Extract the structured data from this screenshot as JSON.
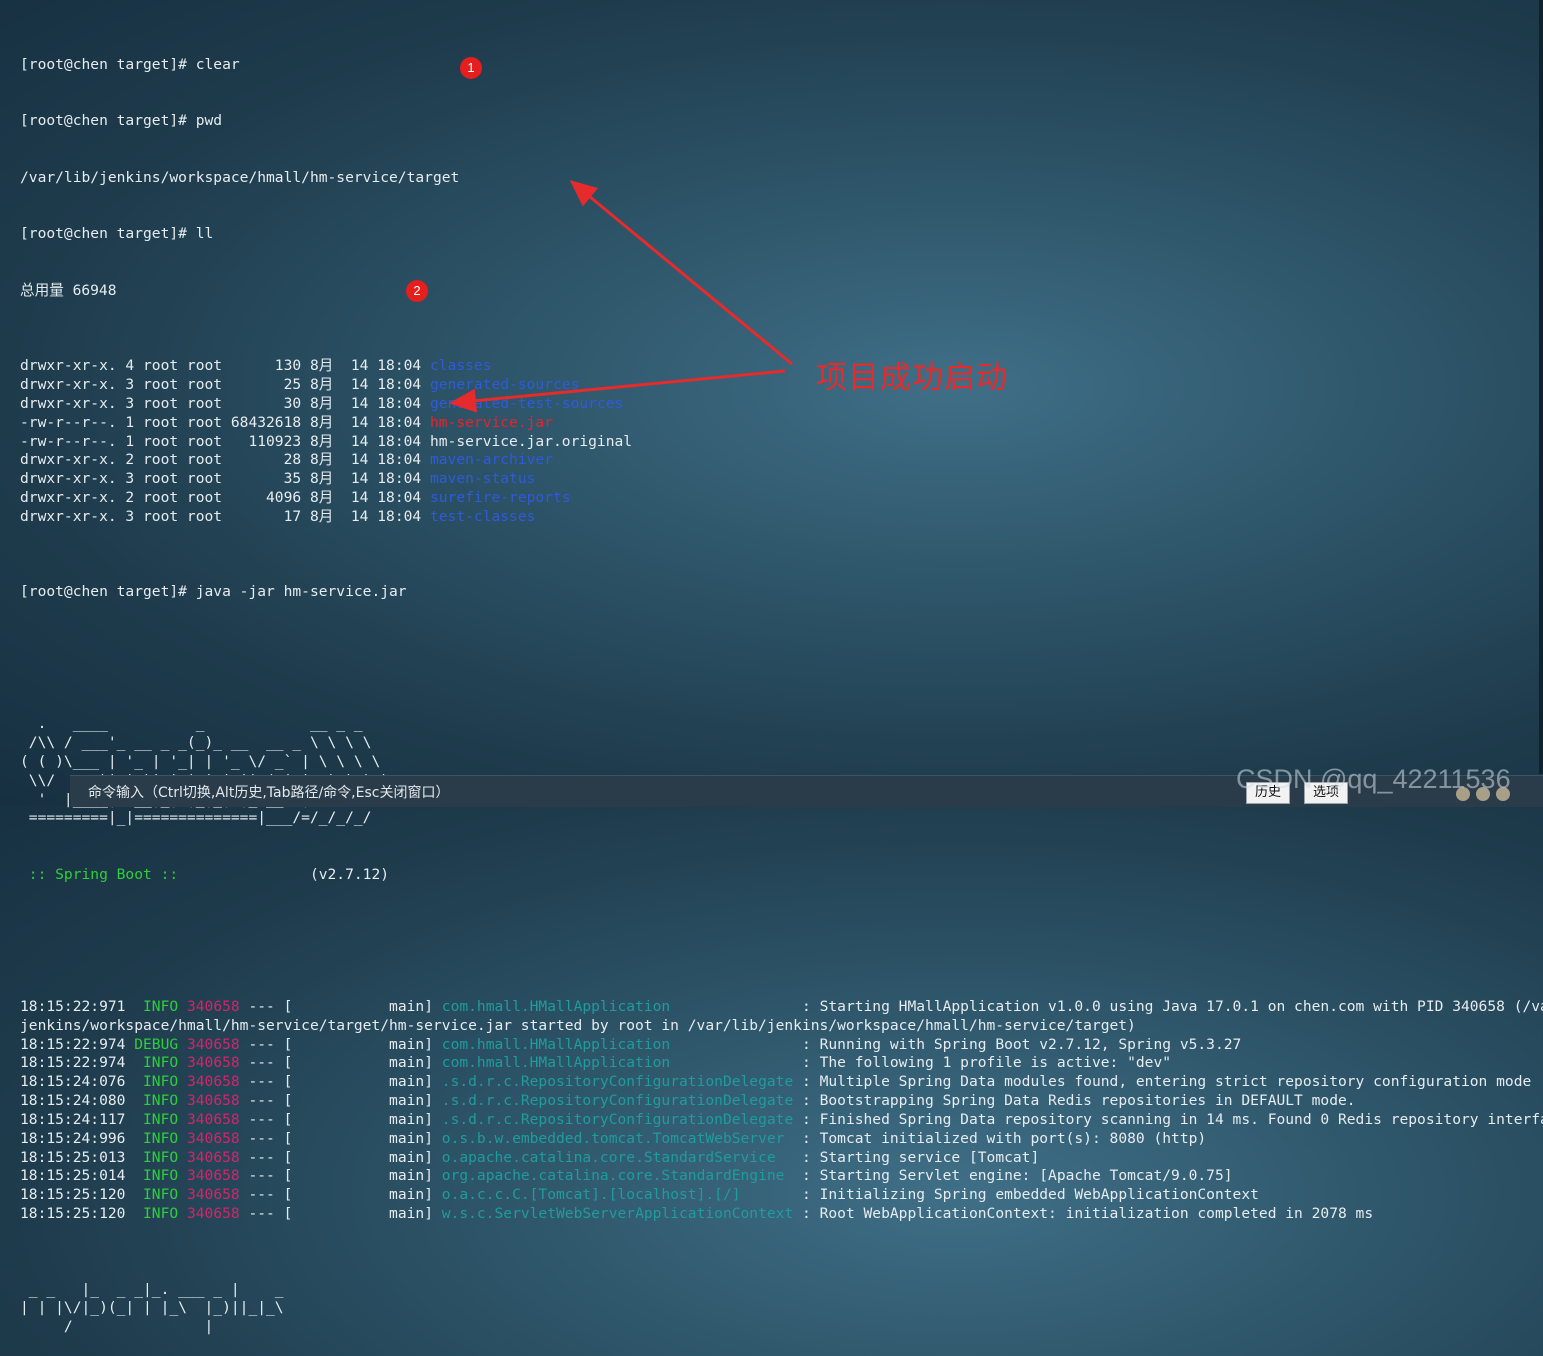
{
  "terminal": {
    "top_lines": [
      "[root@chen target]# clear",
      "[root@chen target]# pwd",
      "/var/lib/jenkins/workspace/hmall/hm-service/target",
      "[root@chen target]# ll",
      "总用量 66948"
    ],
    "listing": [
      {
        "meta": "drwxr-xr-x. 4 root root      130 8月  14 18:04 ",
        "name": "classes",
        "kind": "dir"
      },
      {
        "meta": "drwxr-xr-x. 3 root root       25 8月  14 18:04 ",
        "name": "generated-sources",
        "kind": "dir"
      },
      {
        "meta": "drwxr-xr-x. 3 root root       30 8月  14 18:04 ",
        "name": "generated-test-sources",
        "kind": "dir"
      },
      {
        "meta": "-rw-r--r--. 1 root root 68432618 8月  14 18:04 ",
        "name": "hm-service.jar",
        "kind": "jar"
      },
      {
        "meta": "-rw-r--r--. 1 root root   110923 8月  14 18:04 ",
        "name": "hm-service.jar.original",
        "kind": "file"
      },
      {
        "meta": "drwxr-xr-x. 2 root root       28 8月  14 18:04 ",
        "name": "maven-archiver",
        "kind": "dir"
      },
      {
        "meta": "drwxr-xr-x. 3 root root       35 8月  14 18:04 ",
        "name": "maven-status",
        "kind": "dir"
      },
      {
        "meta": "drwxr-xr-x. 2 root root     4096 8月  14 18:04 ",
        "name": "surefire-reports",
        "kind": "dir"
      },
      {
        "meta": "drwxr-xr-x. 3 root root       17 8月  14 18:04 ",
        "name": "test-classes",
        "kind": "dir"
      }
    ],
    "run_command": "[root@chen target]# java -jar hm-service.jar",
    "banner": [
      "  .   ____          _            __ _ _",
      " /\\\\ / ___'_ __ _ _(_)_ __  __ _ \\ \\ \\ \\",
      "( ( )\\___ | '_ | '_| | '_ \\/ _` | \\ \\ \\ \\",
      " \\\\/  ___)| |_)| | | | | || (_| |  ) ) ) )",
      "  '  |____| .__|_| |_|_| |_\\__, | / / / /",
      " =========|_|==============|___/=/_/_/_/"
    ],
    "banner_footer_label": " :: Spring Boot ::",
    "banner_footer_version": "               (v2.7.12)",
    "log_wrap_line": "jenkins/workspace/hmall/hm-service/target/hm-service.jar started by root in /var/lib/jenkins/workspace/hmall/hm-service/target)",
    "logs": [
      {
        "time": "18:15:22:971",
        "level": " INFO",
        "pid": "340658",
        "sep": " --- [           main] ",
        "logger": "com.hmall.HMallApplication              ",
        "msg": " : Starting HMallApplication v1.0.0 using Java 17.0.1 on chen.com with PID 340658 (/va"
      },
      {
        "time": "18:15:22:974",
        "level": "DEBUG",
        "pid": "340658",
        "sep": " --- [           main] ",
        "logger": "com.hmall.HMallApplication              ",
        "msg": " : Running with Spring Boot v2.7.12, Spring v5.3.27"
      },
      {
        "time": "18:15:22:974",
        "level": " INFO",
        "pid": "340658",
        "sep": " --- [           main] ",
        "logger": "com.hmall.HMallApplication              ",
        "msg": " : The following 1 profile is active: \"dev\""
      },
      {
        "time": "18:15:24:076",
        "level": " INFO",
        "pid": "340658",
        "sep": " --- [           main] ",
        "logger": ".s.d.r.c.RepositoryConfigurationDelegate",
        "msg": " : Multiple Spring Data modules found, entering strict repository configuration mode"
      },
      {
        "time": "18:15:24:080",
        "level": " INFO",
        "pid": "340658",
        "sep": " --- [           main] ",
        "logger": ".s.d.r.c.RepositoryConfigurationDelegate",
        "msg": " : Bootstrapping Spring Data Redis repositories in DEFAULT mode."
      },
      {
        "time": "18:15:24:117",
        "level": " INFO",
        "pid": "340658",
        "sep": " --- [           main] ",
        "logger": ".s.d.r.c.RepositoryConfigurationDelegate",
        "msg": " : Finished Spring Data repository scanning in 14 ms. Found 0 Redis repository interfa"
      },
      {
        "time": "18:15:24:996",
        "level": " INFO",
        "pid": "340658",
        "sep": " --- [           main] ",
        "logger": "o.s.b.w.embedded.tomcat.TomcatWebServer ",
        "msg": " : Tomcat initialized with port(s): 8080 (http)"
      },
      {
        "time": "18:15:25:013",
        "level": " INFO",
        "pid": "340658",
        "sep": " --- [           main] ",
        "logger": "o.apache.catalina.core.StandardService  ",
        "msg": " : Starting service [Tomcat]"
      },
      {
        "time": "18:15:25:014",
        "level": " INFO",
        "pid": "340658",
        "sep": " --- [           main] ",
        "logger": "org.apache.catalina.core.StandardEngine ",
        "msg": " : Starting Servlet engine: [Apache Tomcat/9.0.75]"
      },
      {
        "time": "18:15:25:120",
        "level": " INFO",
        "pid": "340658",
        "sep": " --- [           main] ",
        "logger": "o.a.c.c.C.[Tomcat].[localhost].[/]      ",
        "msg": " : Initializing Spring embedded WebApplicationContext"
      },
      {
        "time": "18:15:25:120",
        "level": " INFO",
        "pid": "340658",
        "sep": " --- [           main] ",
        "logger": "w.s.c.ServletWebServerApplicationContext",
        "msg": " : Root WebApplicationContext: initialization completed in 2078 ms"
      }
    ],
    "tail_art": [
      " _ _   |_  _ _|_. ___ _ |    _",
      "| | |\\/|_)(_| | |_\\  |_)||_|_\\",
      "     /               |"
    ]
  },
  "annotations": {
    "marker_1": "1",
    "marker_2": "2",
    "callout_text": "项目成功启动"
  },
  "command_bar": {
    "label": "命令输入（Ctrl切换,Alt历史,Tab路径/命令,Esc关闭窗口）",
    "history_button": "历史",
    "options_button": "选项"
  },
  "watermark": "CSDN @qq_42211536",
  "colors": {
    "dir": "#2f5bd9",
    "jar": "#e8232c",
    "info": "#2fcf3a",
    "pid": "#d4246b",
    "logger": "#1f9c9c",
    "annotation": "#e52b2b"
  }
}
